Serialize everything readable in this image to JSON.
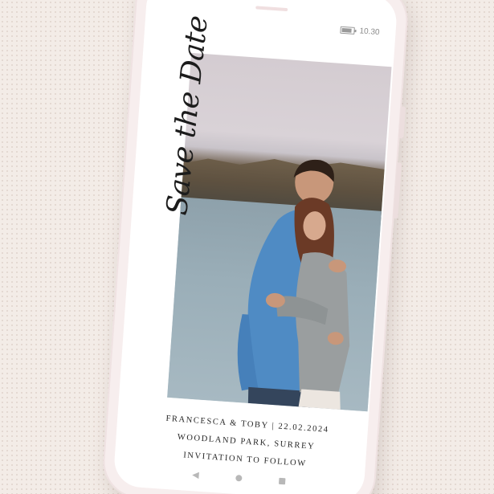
{
  "status_bar": {
    "time": "10.30"
  },
  "card": {
    "script_title": "Save the Date",
    "names_line": "FRANCESCA & TOBY  |  22.02.2024",
    "venue_line": "WOODLAND PARK, SURREY",
    "note_line": "INVITATION TO FOLLOW"
  },
  "navigation": {
    "back_glyph": "◀"
  },
  "colors": {
    "background": "#f3ece7",
    "phone_frame": "#f7eeee",
    "text": "#262626",
    "shirt": "#4f8bc4",
    "sweater": "#9a9e9f",
    "hair": "#6b3a26"
  }
}
